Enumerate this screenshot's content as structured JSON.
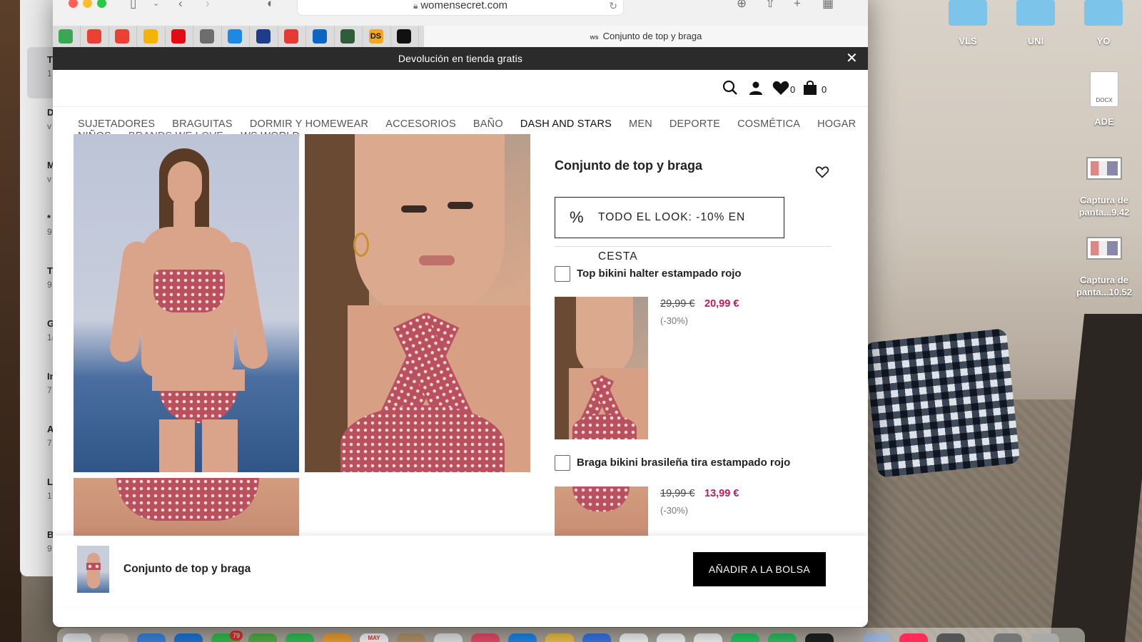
{
  "browser": {
    "url": "womensecret.com",
    "active_tab_title": "Conjunto de top y braga",
    "active_tab_favicon": "ws"
  },
  "favorites": [
    {
      "icon": "maps-icon",
      "color": "#3aa852"
    },
    {
      "icon": "gmail-icon",
      "color": "#e94235"
    },
    {
      "icon": "gmail-icon",
      "color": "#e94235"
    },
    {
      "icon": "google-drive-icon",
      "color": "#f4b400"
    },
    {
      "icon": "netflix-icon",
      "color": "#e50914"
    },
    {
      "icon": "cloud-icon",
      "color": "#6d6d6d"
    },
    {
      "icon": "c-icon",
      "color": "#1e88e5"
    },
    {
      "icon": "app-icon",
      "color": "#1f3b8c"
    },
    {
      "icon": "deviantart-icon",
      "color": "#e53935"
    },
    {
      "icon": "linkedin-icon",
      "color": "#0a66c2"
    },
    {
      "icon": "app-icon",
      "color": "#2f5d3a"
    },
    {
      "icon": "ds-icon",
      "color": "#f5a623",
      "text": "DS"
    },
    {
      "icon": "circle-icon",
      "color": "#111111"
    }
  ],
  "promo_bar": {
    "text": "Devolución en tienda gratis"
  },
  "header": {
    "wishlist_count": "0",
    "bag_count": "0"
  },
  "nav": {
    "row1": [
      "SUJETADORES",
      "BRAGUITAS",
      "DORMIR Y HOMEWEAR",
      "ACCESORIOS",
      "BAÑO",
      "DASH AND STARS",
      "MEN",
      "DEPORTE",
      "COSMÉTICA",
      "HOGAR"
    ],
    "row2": [
      "NIÑOS",
      "BRANDS WE LOVE",
      "WS WORLD"
    ]
  },
  "product": {
    "title": "Conjunto de top y braga",
    "look_promo": "TODO EL LOOK: -10% EN CESTA",
    "items": [
      {
        "name": "Top bikini halter estampado rojo",
        "old_price": "29,99 €",
        "new_price": "20,99 €",
        "discount": "(-30%)"
      },
      {
        "name": "Braga bikini brasileña tira estampado rojo",
        "old_price": "19,99 €",
        "new_price": "13,99 €",
        "discount": "(-30%)"
      }
    ]
  },
  "sticky": {
    "title": "Conjunto de top y braga",
    "add_to_bag": "AÑADIR A LA BOLSA"
  },
  "desktop": {
    "folders": [
      "VLS",
      "UNI",
      "YO"
    ],
    "file_label": "ADE",
    "file_type": "DOCX",
    "screenshots": [
      {
        "line1": "Captura de",
        "line2": "panta...9.42"
      },
      {
        "line1": "Captura de",
        "line2": "panta...10.52"
      }
    ]
  },
  "back_window": {
    "rows": [
      "T",
      "D",
      "M",
      "*",
      "T",
      "G",
      "In",
      "A",
      "L",
      "B"
    ],
    "subs": [
      "1",
      "v",
      "v",
      "9",
      "9",
      "1(",
      "7.",
      "7.",
      "1!",
      "9"
    ]
  },
  "dock": {
    "badge": "79",
    "calendar_month": "MAY"
  }
}
